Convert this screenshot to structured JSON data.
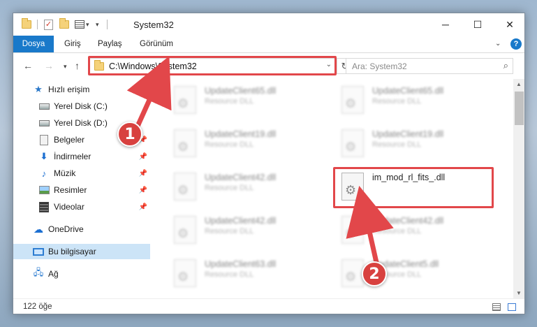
{
  "window": {
    "title": "System32",
    "minimize_glyph": "─",
    "maximize_glyph": "☐",
    "close_glyph": "✕"
  },
  "ribbon": {
    "tabs": [
      "Dosya",
      "Giriş",
      "Paylaş",
      "Görünüm"
    ],
    "accent": "#1979ca",
    "help_glyph": "?"
  },
  "address": {
    "path": "C:\\Windows\\System32",
    "search_placeholder": "Ara: System32"
  },
  "nav_pane": {
    "items": [
      {
        "label": "Hızlı erişim",
        "icon": "star-icon"
      },
      {
        "label": "Yerel Disk (C:)",
        "icon": "disk-icon"
      },
      {
        "label": "Yerel Disk (D:)",
        "icon": "disk-icon"
      },
      {
        "label": "Belgeler",
        "icon": "documents-icon"
      },
      {
        "label": "İndirmeler",
        "icon": "download-icon"
      },
      {
        "label": "Müzik",
        "icon": "music-icon"
      },
      {
        "label": "Resimler",
        "icon": "pictures-icon"
      },
      {
        "label": "Videolar",
        "icon": "videos-icon"
      },
      {
        "label": "OneDrive",
        "icon": "cloud-icon"
      },
      {
        "label": "Bu bilgisayar",
        "icon": "computer-icon",
        "selected": true
      },
      {
        "label": "Ağ",
        "icon": "network-icon"
      }
    ]
  },
  "files": [
    {
      "name": "UpdateClient65.dll",
      "desc": "Resource DLL"
    },
    {
      "name": "UpdateClient65.dll",
      "desc": "Resource DLL"
    },
    {
      "name": "UpdateClient19.dll",
      "desc": "Resource DLL"
    },
    {
      "name": "UpdateClient19.dll",
      "desc": "Resource DLL"
    },
    {
      "name": "UpdateClient42.dll",
      "desc": "Resource DLL"
    },
    {
      "name": "im_mod_rl_fits_.dll",
      "desc": ""
    },
    {
      "name": "UpdateClient42.dll",
      "desc": "Resource DLL"
    },
    {
      "name": "UpdateClient42.dll",
      "desc": "Resource DLL"
    },
    {
      "name": "UpdateClient63.dll",
      "desc": "Resource DLL"
    },
    {
      "name": "UpdateClient5.dll",
      "desc": "Resource DLL"
    }
  ],
  "status": {
    "item_count": "122 öğe"
  },
  "annotations": {
    "color": "#e2474a",
    "step1": "1",
    "step2": "2"
  }
}
